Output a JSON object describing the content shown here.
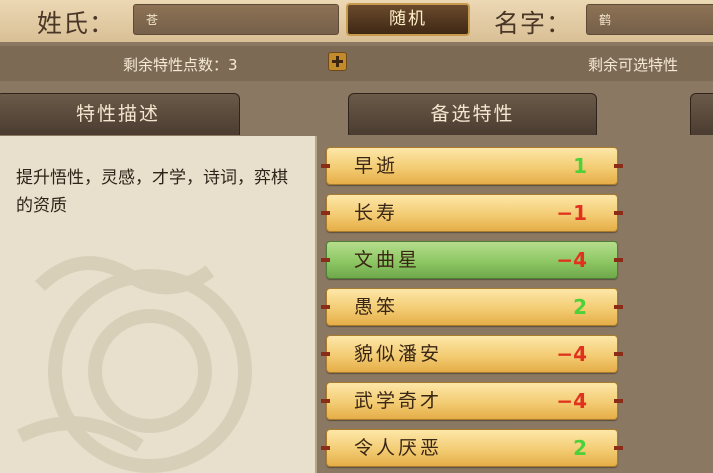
{
  "header": {
    "surname_label": "姓氏：",
    "surname_value": "苍",
    "random_label": "随机",
    "given_name_label": "名字：",
    "given_name_value": "鹤"
  },
  "points": {
    "remaining_points_label": "剩余特性点数：3",
    "remaining_selectable_label": "剩余可选特性"
  },
  "tabs": {
    "description": "特性描述",
    "candidates": "备选特性"
  },
  "description": {
    "text": "提升悟性，灵感，才学，诗词，弈棋的资质"
  },
  "traits": [
    {
      "name": "早逝",
      "value": "1"
    },
    {
      "name": "长寿",
      "value": "−1"
    },
    {
      "name": "文曲星",
      "value": "−4",
      "selected": true
    },
    {
      "name": "愚笨",
      "value": "2"
    },
    {
      "name": "貌似潘安",
      "value": "−4"
    },
    {
      "name": "武学奇才",
      "value": "−4"
    },
    {
      "name": "令人厌恶",
      "value": "2"
    }
  ],
  "colors": {
    "positive_value": "#4cd13a",
    "negative_value": "#e0321e",
    "trait_normal": "#f3cc73",
    "trait_selected": "#8dc764"
  }
}
